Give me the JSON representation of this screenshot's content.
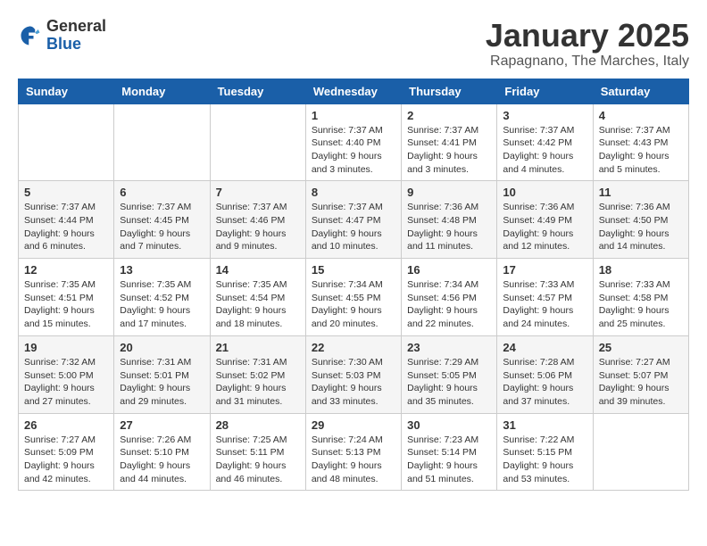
{
  "header": {
    "logo_general": "General",
    "logo_blue": "Blue",
    "month_title": "January 2025",
    "location": "Rapagnano, The Marches, Italy"
  },
  "days_of_week": [
    "Sunday",
    "Monday",
    "Tuesday",
    "Wednesday",
    "Thursday",
    "Friday",
    "Saturday"
  ],
  "weeks": [
    [
      {
        "day": "",
        "info": ""
      },
      {
        "day": "",
        "info": ""
      },
      {
        "day": "",
        "info": ""
      },
      {
        "day": "1",
        "info": "Sunrise: 7:37 AM\nSunset: 4:40 PM\nDaylight: 9 hours\nand 3 minutes."
      },
      {
        "day": "2",
        "info": "Sunrise: 7:37 AM\nSunset: 4:41 PM\nDaylight: 9 hours\nand 3 minutes."
      },
      {
        "day": "3",
        "info": "Sunrise: 7:37 AM\nSunset: 4:42 PM\nDaylight: 9 hours\nand 4 minutes."
      },
      {
        "day": "4",
        "info": "Sunrise: 7:37 AM\nSunset: 4:43 PM\nDaylight: 9 hours\nand 5 minutes."
      }
    ],
    [
      {
        "day": "5",
        "info": "Sunrise: 7:37 AM\nSunset: 4:44 PM\nDaylight: 9 hours\nand 6 minutes."
      },
      {
        "day": "6",
        "info": "Sunrise: 7:37 AM\nSunset: 4:45 PM\nDaylight: 9 hours\nand 7 minutes."
      },
      {
        "day": "7",
        "info": "Sunrise: 7:37 AM\nSunset: 4:46 PM\nDaylight: 9 hours\nand 9 minutes."
      },
      {
        "day": "8",
        "info": "Sunrise: 7:37 AM\nSunset: 4:47 PM\nDaylight: 9 hours\nand 10 minutes."
      },
      {
        "day": "9",
        "info": "Sunrise: 7:36 AM\nSunset: 4:48 PM\nDaylight: 9 hours\nand 11 minutes."
      },
      {
        "day": "10",
        "info": "Sunrise: 7:36 AM\nSunset: 4:49 PM\nDaylight: 9 hours\nand 12 minutes."
      },
      {
        "day": "11",
        "info": "Sunrise: 7:36 AM\nSunset: 4:50 PM\nDaylight: 9 hours\nand 14 minutes."
      }
    ],
    [
      {
        "day": "12",
        "info": "Sunrise: 7:35 AM\nSunset: 4:51 PM\nDaylight: 9 hours\nand 15 minutes."
      },
      {
        "day": "13",
        "info": "Sunrise: 7:35 AM\nSunset: 4:52 PM\nDaylight: 9 hours\nand 17 minutes."
      },
      {
        "day": "14",
        "info": "Sunrise: 7:35 AM\nSunset: 4:54 PM\nDaylight: 9 hours\nand 18 minutes."
      },
      {
        "day": "15",
        "info": "Sunrise: 7:34 AM\nSunset: 4:55 PM\nDaylight: 9 hours\nand 20 minutes."
      },
      {
        "day": "16",
        "info": "Sunrise: 7:34 AM\nSunset: 4:56 PM\nDaylight: 9 hours\nand 22 minutes."
      },
      {
        "day": "17",
        "info": "Sunrise: 7:33 AM\nSunset: 4:57 PM\nDaylight: 9 hours\nand 24 minutes."
      },
      {
        "day": "18",
        "info": "Sunrise: 7:33 AM\nSunset: 4:58 PM\nDaylight: 9 hours\nand 25 minutes."
      }
    ],
    [
      {
        "day": "19",
        "info": "Sunrise: 7:32 AM\nSunset: 5:00 PM\nDaylight: 9 hours\nand 27 minutes."
      },
      {
        "day": "20",
        "info": "Sunrise: 7:31 AM\nSunset: 5:01 PM\nDaylight: 9 hours\nand 29 minutes."
      },
      {
        "day": "21",
        "info": "Sunrise: 7:31 AM\nSunset: 5:02 PM\nDaylight: 9 hours\nand 31 minutes."
      },
      {
        "day": "22",
        "info": "Sunrise: 7:30 AM\nSunset: 5:03 PM\nDaylight: 9 hours\nand 33 minutes."
      },
      {
        "day": "23",
        "info": "Sunrise: 7:29 AM\nSunset: 5:05 PM\nDaylight: 9 hours\nand 35 minutes."
      },
      {
        "day": "24",
        "info": "Sunrise: 7:28 AM\nSunset: 5:06 PM\nDaylight: 9 hours\nand 37 minutes."
      },
      {
        "day": "25",
        "info": "Sunrise: 7:27 AM\nSunset: 5:07 PM\nDaylight: 9 hours\nand 39 minutes."
      }
    ],
    [
      {
        "day": "26",
        "info": "Sunrise: 7:27 AM\nSunset: 5:09 PM\nDaylight: 9 hours\nand 42 minutes."
      },
      {
        "day": "27",
        "info": "Sunrise: 7:26 AM\nSunset: 5:10 PM\nDaylight: 9 hours\nand 44 minutes."
      },
      {
        "day": "28",
        "info": "Sunrise: 7:25 AM\nSunset: 5:11 PM\nDaylight: 9 hours\nand 46 minutes."
      },
      {
        "day": "29",
        "info": "Sunrise: 7:24 AM\nSunset: 5:13 PM\nDaylight: 9 hours\nand 48 minutes."
      },
      {
        "day": "30",
        "info": "Sunrise: 7:23 AM\nSunset: 5:14 PM\nDaylight: 9 hours\nand 51 minutes."
      },
      {
        "day": "31",
        "info": "Sunrise: 7:22 AM\nSunset: 5:15 PM\nDaylight: 9 hours\nand 53 minutes."
      },
      {
        "day": "",
        "info": ""
      }
    ]
  ]
}
